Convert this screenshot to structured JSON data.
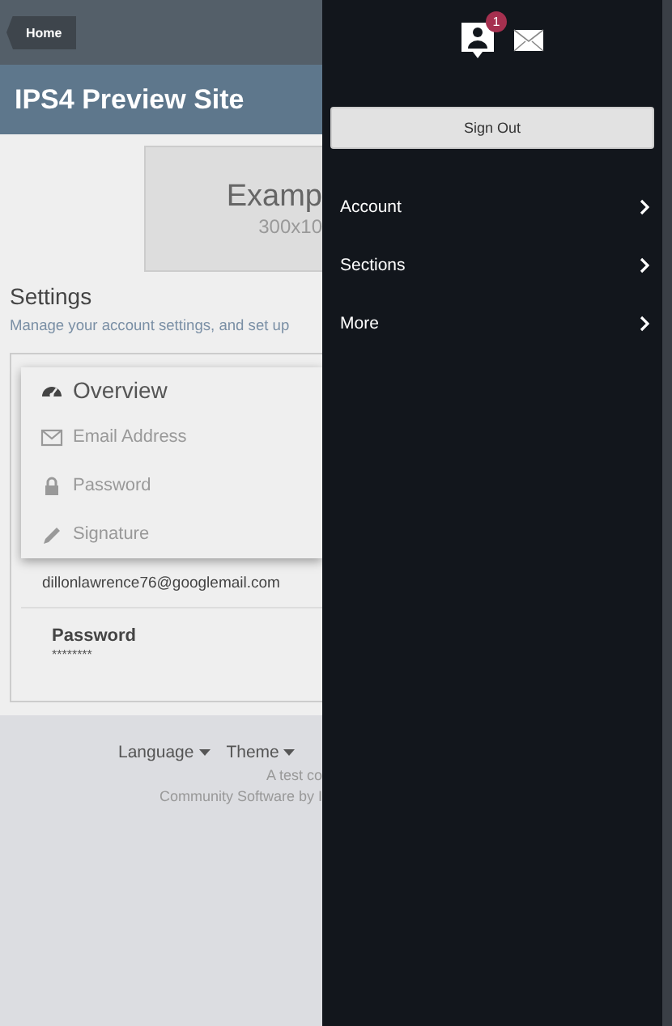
{
  "breadcrumb": "Home",
  "site_title": "IPS4 Preview Site",
  "ad": {
    "title": "Examp",
    "size": "300x10"
  },
  "settings": {
    "heading": "Settings",
    "description": "Manage your account settings, and set up"
  },
  "settings_menu": [
    {
      "label": "Overview",
      "kind": "title"
    },
    {
      "label": "Email Address",
      "kind": "item"
    },
    {
      "label": "Password",
      "kind": "item"
    },
    {
      "label": "Signature",
      "kind": "item"
    }
  ],
  "email_value": "dillonlawrence76@googlemail.com",
  "password": {
    "label": "Password",
    "value": "********"
  },
  "footer": {
    "links": [
      "Language",
      "Theme"
    ],
    "lines": [
      "A test co",
      "Community Software by I"
    ]
  },
  "drawer": {
    "notification_count": "1",
    "sign_out": "Sign Out",
    "items": [
      "Account",
      "Sections",
      "More"
    ]
  }
}
